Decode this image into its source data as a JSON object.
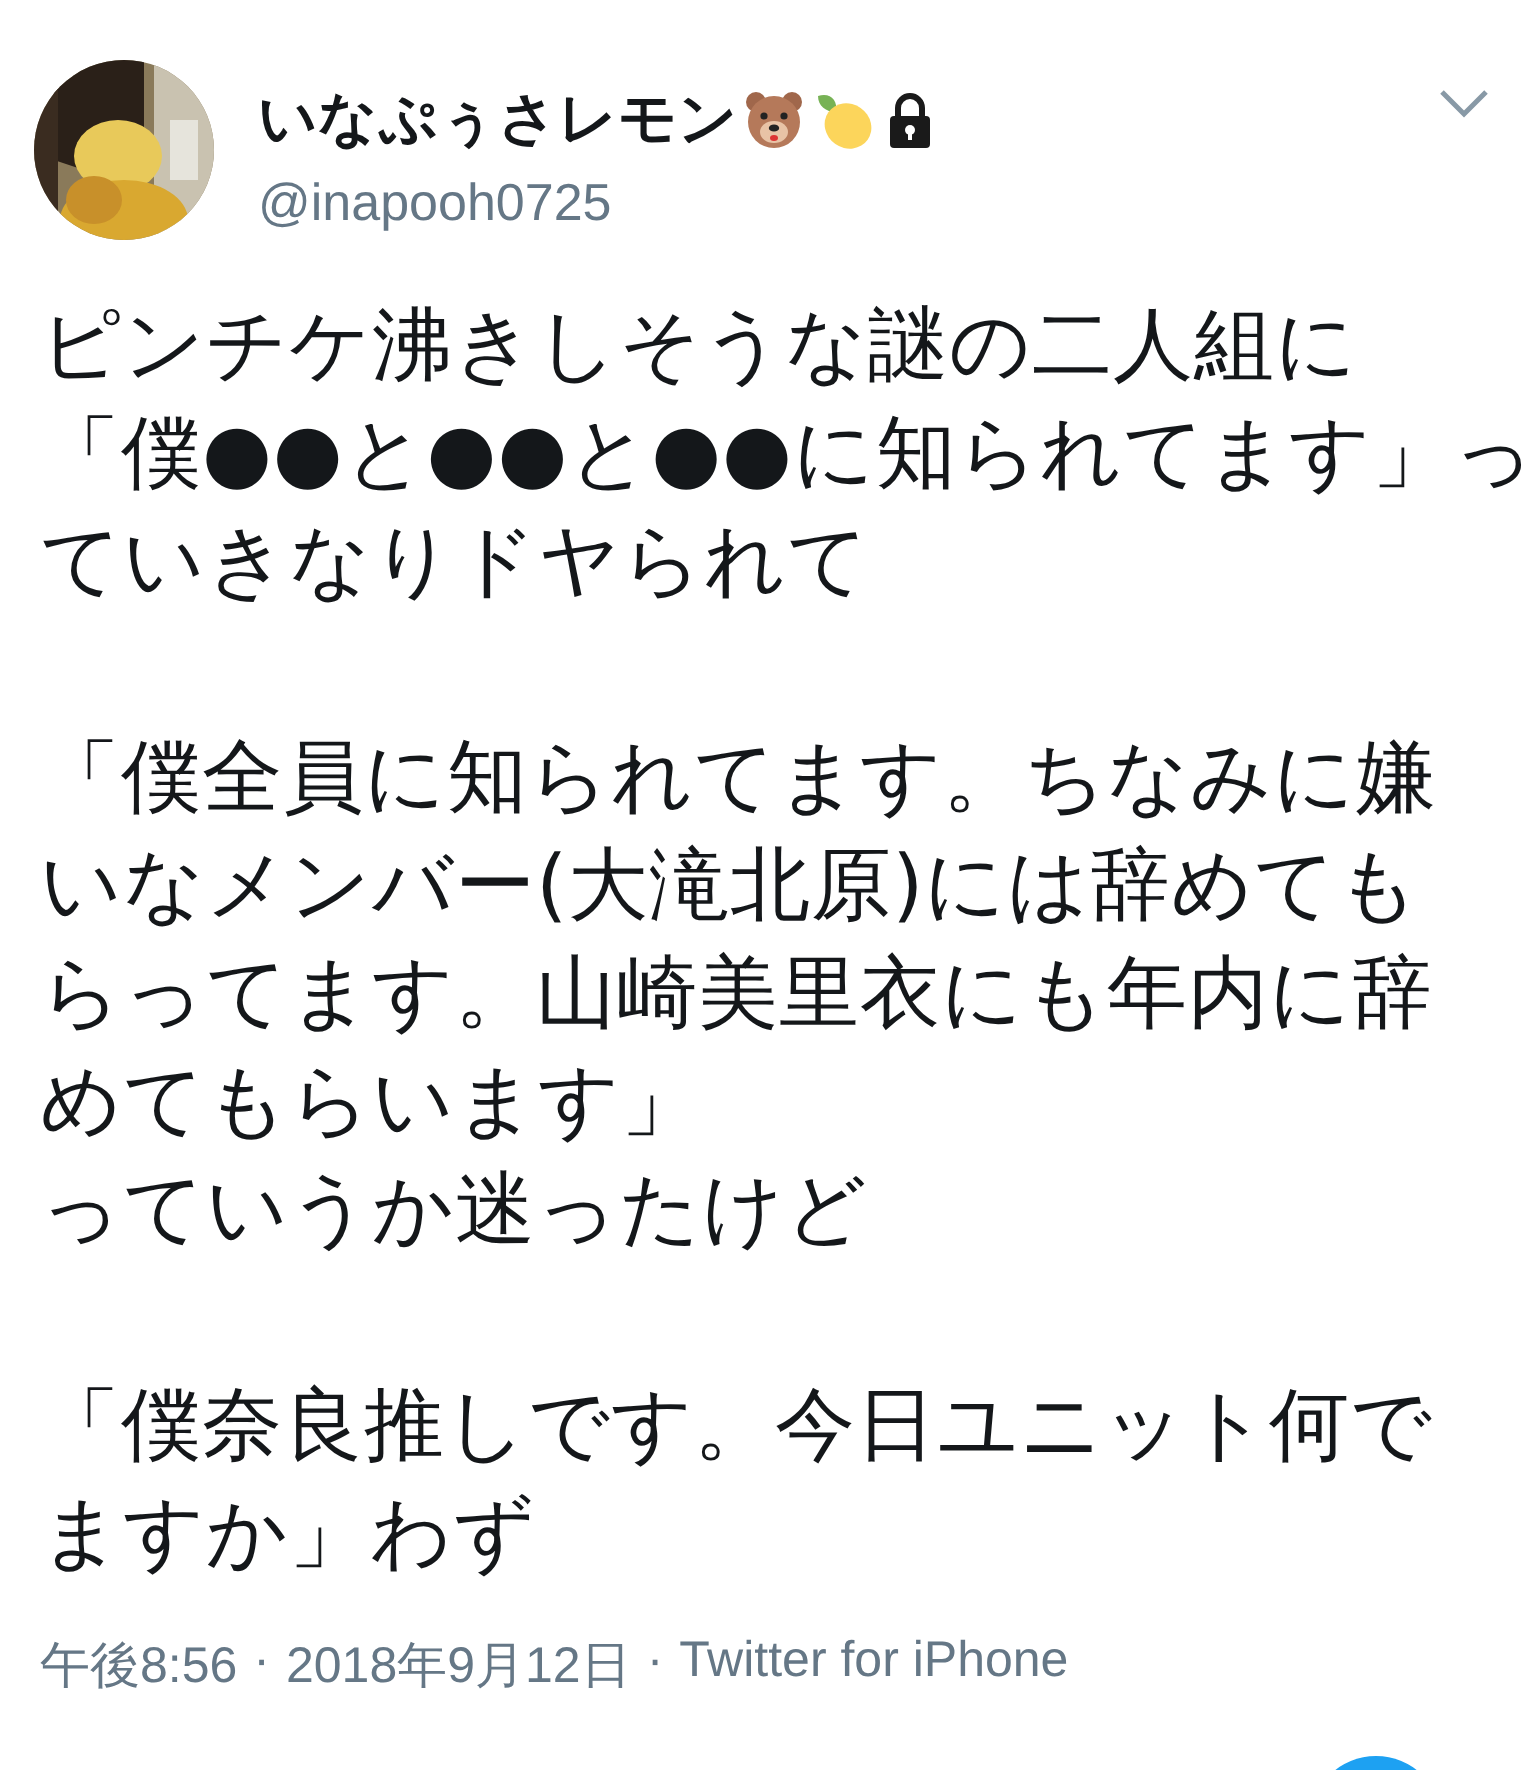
{
  "tweet": {
    "author": {
      "name": "いなぷぅさレモン",
      "handle": "@inapooh0725",
      "locked": true
    },
    "paragraphs": [
      {
        "lines": [
          "ピンチケ沸きしそうな謎の二人組に",
          "「僕●●と●●と●●に知られてます」っ",
          "ていきなりドヤられて"
        ]
      },
      {
        "lines": [
          "「僕全員に知られてます。ちなみに嫌",
          "いなメンバー(大滝北原)には辞めても",
          "らってます。山崎美里衣にも年内に辞",
          "めてもらいます」",
          "っていうか迷ったけど"
        ]
      },
      {
        "lines": [
          "「僕奈良推しです。今日ユニット何で",
          "ますか」わず"
        ]
      }
    ],
    "time": "午後8:56",
    "separator": "·",
    "date": "2018年9月12日",
    "source": "Twitter for iPhone"
  }
}
